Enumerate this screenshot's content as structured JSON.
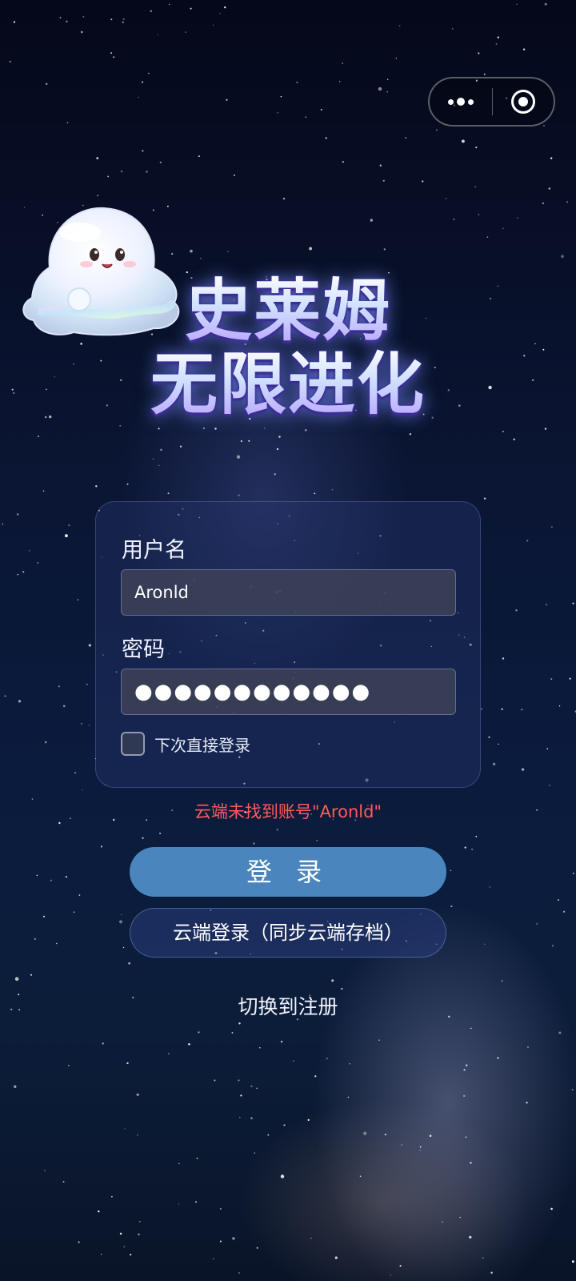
{
  "capsule": {
    "more_icon": "more-dots-icon",
    "close_icon": "record-target-icon"
  },
  "mascot": {
    "icon": "slime-mascot"
  },
  "title": {
    "line1": "史莱姆",
    "line2": "无限进化"
  },
  "form": {
    "username_label": "用户名",
    "username_value": "Aronld",
    "password_label": "密码",
    "password_value": "●●●●●●●●●●●●",
    "remember_label": "下次直接登录",
    "remember_checked": false
  },
  "error_message": "云端未找到账号\"Aronld\"",
  "buttons": {
    "login": "登 录",
    "cloud_login": "云端登录（同步云端存档）",
    "switch_register": "切换到注册"
  },
  "colors": {
    "login_button": "#4a86bd",
    "error": "#ff5a5a",
    "background": "#0a1532"
  }
}
